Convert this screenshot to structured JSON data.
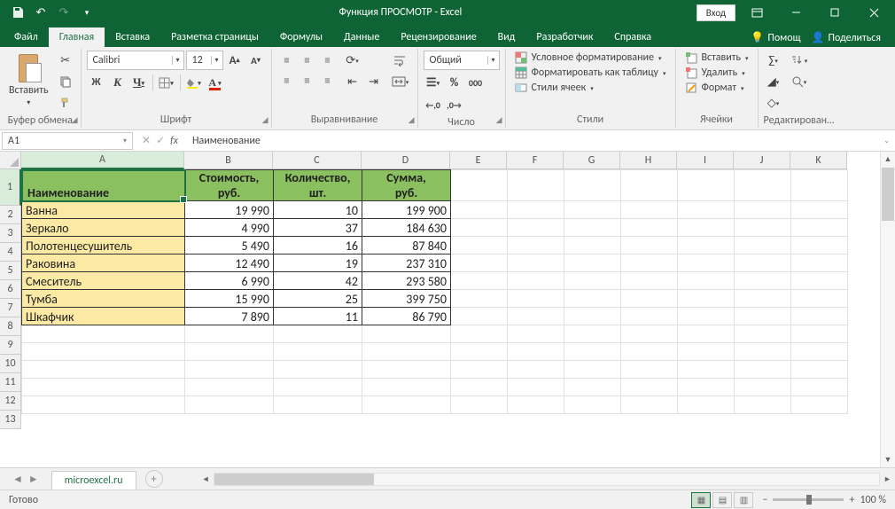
{
  "title": "Функция ПРОСМОТР  -  Excel",
  "login": "Вход",
  "tabs": [
    "Файл",
    "Главная",
    "Вставка",
    "Разметка страницы",
    "Формулы",
    "Данные",
    "Рецензирование",
    "Вид",
    "Разработчик",
    "Справка"
  ],
  "active_tab": 1,
  "help": "Помощ",
  "share": "Поделиться",
  "ribbon": {
    "clipboard": {
      "paste": "Вставить",
      "label": "Буфер обмена"
    },
    "font": {
      "name": "Calibri",
      "size": "12",
      "label": "Шрифт"
    },
    "align": {
      "label": "Выравнивание"
    },
    "number": {
      "format": "Общий",
      "label": "Число"
    },
    "styles": {
      "cond": "Условное форматирование",
      "table": "Форматировать как таблицу",
      "cell": "Стили ячеек",
      "label": "Стили"
    },
    "cells": {
      "insert": "Вставить",
      "delete": "Удалить",
      "format": "Формат",
      "label": "Ячейки"
    },
    "editing": {
      "label": "Редактирован…"
    }
  },
  "name_box": "A1",
  "formula": "Наименование",
  "columns": [
    {
      "l": "A",
      "w": 184
    },
    {
      "l": "B",
      "w": 100
    },
    {
      "l": "C",
      "w": 100
    },
    {
      "l": "D",
      "w": 100
    },
    {
      "l": "E",
      "w": 64
    },
    {
      "l": "F",
      "w": 64
    },
    {
      "l": "G",
      "w": 64
    },
    {
      "l": "H",
      "w": 64
    },
    {
      "l": "I",
      "w": 64
    },
    {
      "l": "J",
      "w": 64
    },
    {
      "l": "K",
      "w": 64
    }
  ],
  "headers": [
    "Наименование",
    "Стоимость, руб.",
    "Количество, шт.",
    "Сумма, руб."
  ],
  "rows": [
    {
      "n": "Ванна",
      "c": "19 990",
      "q": "10",
      "s": "199 900"
    },
    {
      "n": "Зеркало",
      "c": "4 990",
      "q": "37",
      "s": "184 630"
    },
    {
      "n": "Полотенцесушитель",
      "c": "5 490",
      "q": "16",
      "s": "87 840"
    },
    {
      "n": "Раковина",
      "c": "12 490",
      "q": "19",
      "s": "237 310"
    },
    {
      "n": "Смеситель",
      "c": "6 990",
      "q": "42",
      "s": "293 580"
    },
    {
      "n": "Тумба",
      "c": "15 990",
      "q": "25",
      "s": "399 750"
    },
    {
      "n": "Шкафчик",
      "c": "7 890",
      "q": "11",
      "s": "86 790"
    }
  ],
  "sheet_name": "microexcel.ru",
  "status": "Готово",
  "zoom": "100 %"
}
